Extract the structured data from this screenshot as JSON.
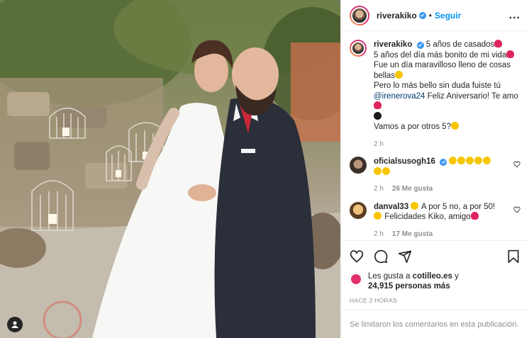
{
  "header": {
    "username": "riverakiko",
    "separator": "•",
    "follow_label": "Seguir",
    "more_label": "..."
  },
  "caption": {
    "username": "riverakiko",
    "line1": "5 años de casados",
    "line2": "5 años del día más bonito de mi vida",
    "line3": "Fue un día maravilloso lleno de cosas bellas",
    "line4": "Pero lo más bello sin duda fuiste tú",
    "mention": "@irenerova24",
    "line5": "Feliz Aniversario! Te amo",
    "line6": "Vamos a por otros 5?",
    "time": "2 h"
  },
  "comments": [
    {
      "username": "oficialsusogh16",
      "time": "2 h",
      "likes": "26 Me gusta"
    },
    {
      "username": "danval33",
      "text_a": "A por 5 no, a por 50!",
      "text_b": "Felicidades Kiko, amigo",
      "time": "2 h",
      "likes": "17 Me gusta"
    }
  ],
  "likes": {
    "prefix": "Les gusta a",
    "user": "cotilleo.es",
    "and": "y",
    "count": "24,915 personas más"
  },
  "posted_ago": "HACE 2 HORAS",
  "comments_disabled": "Se limitaron los comentarios en esta publicación.",
  "icons": [
    "heart-icon",
    "comment-icon",
    "share-icon",
    "bookmark-icon",
    "verified-icon",
    "user-tag-icon"
  ],
  "colors": {
    "accent": "#0095f6",
    "verified": "#3897f0",
    "muted": "#8e8e8e",
    "mention": "#00376b"
  }
}
